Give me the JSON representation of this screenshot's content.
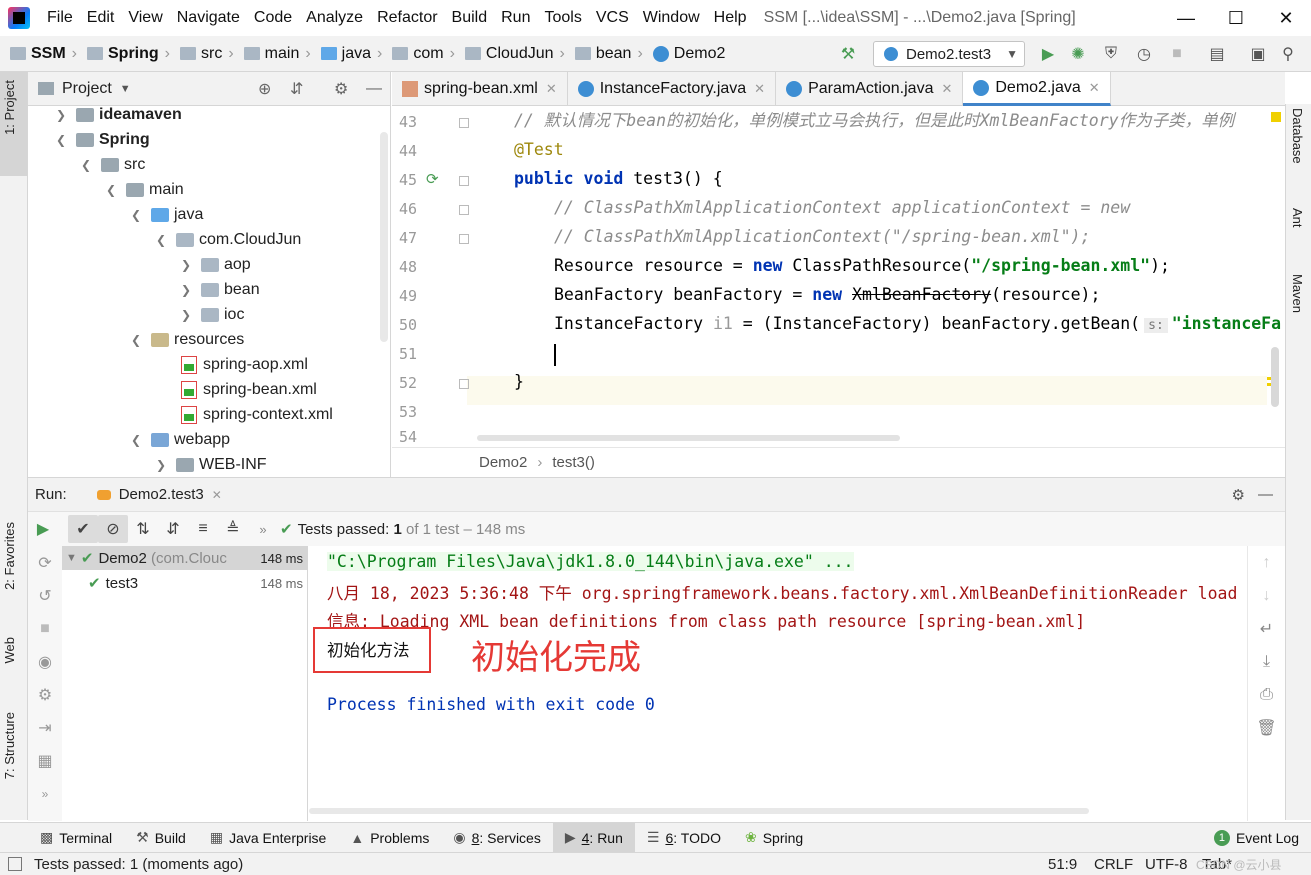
{
  "window": {
    "menu": [
      "File",
      "Edit",
      "View",
      "Navigate",
      "Code",
      "Analyze",
      "Refactor",
      "Build",
      "Run",
      "Tools",
      "VCS",
      "Window",
      "Help"
    ],
    "title": "SSM [...\\idea\\SSM] - ...\\Demo2.java [Spring]"
  },
  "navbar": {
    "breadcrumbs": [
      "SSM",
      "Spring",
      "src",
      "main",
      "java",
      "com",
      "CloudJun",
      "bean",
      "Demo2"
    ],
    "run_config": "Demo2.test3"
  },
  "side_tabs": {
    "left_top": "1: Project",
    "left_favorites": "2: Favorites",
    "left_web": "Web",
    "left_structure": "7: Structure",
    "right": [
      "Database",
      "Ant",
      "Maven"
    ]
  },
  "project": {
    "header": "Project",
    "tree": [
      {
        "label": "ideamaven",
        "bold": true
      },
      {
        "label": "Spring",
        "bold": true
      },
      {
        "label": "src"
      },
      {
        "label": "main"
      },
      {
        "label": "java"
      },
      {
        "label": "com.CloudJun"
      },
      {
        "label": "aop"
      },
      {
        "label": "bean"
      },
      {
        "label": "ioc"
      },
      {
        "label": "resources"
      },
      {
        "label": "spring-aop.xml"
      },
      {
        "label": "spring-bean.xml"
      },
      {
        "label": "spring-context.xml"
      },
      {
        "label": "webapp"
      },
      {
        "label": "WEB-INF"
      }
    ]
  },
  "editor": {
    "tabs": [
      "spring-bean.xml",
      "InstanceFactory.java",
      "ParamAction.java",
      "Demo2.java"
    ],
    "active_tab": "Demo2.java",
    "line_numbers": [
      "43",
      "44",
      "45",
      "46",
      "47",
      "48",
      "49",
      "50",
      "51",
      "52",
      "53",
      "54"
    ],
    "lines": {
      "l43": "// 默认情况下bean的初始化，单例模式立马会执行，但是此时XmlBeanFactory作为子类，单例",
      "l44": "@Test",
      "l45_kw1": "public",
      "l45_kw2": "void",
      "l45_rest": " test3() {",
      "l46": "// ClassPathXmlApplicationContext applicationContext = new",
      "l47": "// ClassPathXmlApplicationContext(\"/spring-bean.xml\");",
      "l48_a": "Resource resource = ",
      "l48_kw": "new",
      "l48_b": " ClassPathResource(",
      "l48_str": "\"/spring-bean.xml\"",
      "l48_c": ");",
      "l49_a": "BeanFactory beanFactory = ",
      "l49_kw": "new",
      "l49_strike": "XmlBeanFactory",
      "l49_c": "(resource);",
      "l50_a": "InstanceFactory ",
      "l50_var": "i1",
      "l50_b": " = (InstanceFactory) beanFactory.getBean(",
      "l50_hint": "s:",
      "l50_str": "\"instanceFa",
      "l52": "}"
    },
    "breadcrumb": [
      "Demo2",
      "test3()"
    ]
  },
  "run": {
    "label": "Run:",
    "tab": "Demo2.test3",
    "status_prefix": "Tests passed:",
    "status_count": "1",
    "status_suffix": "of 1 test – 148 ms",
    "tree": [
      {
        "name": "Demo2",
        "detail": "(com.Clouc",
        "time": "148 ms"
      },
      {
        "name": "test3",
        "time": "148 ms"
      }
    ],
    "console": [
      "\"C:\\Program Files\\Java\\jdk1.8.0_144\\bin\\java.exe\" ...",
      "八月 18, 2023 5:36:48 下午 org.springframework.beans.factory.xml.XmlBeanDefinitionReader load",
      "信息: Loading XML bean definitions from class path resource [spring-bean.xml]",
      "初始化方法",
      "Process finished with exit code 0"
    ],
    "annotation": "初始化完成"
  },
  "bottom_tools": [
    {
      "key": "",
      "label": "Terminal"
    },
    {
      "key": "",
      "label": "Build"
    },
    {
      "key": "",
      "label": "Java Enterprise"
    },
    {
      "key": "",
      "label": "Problems"
    },
    {
      "key": "8",
      "label": ": Services"
    },
    {
      "key": "4",
      "label": ": Run"
    },
    {
      "key": "6",
      "label": ": TODO"
    },
    {
      "key": "",
      "label": "Spring"
    }
  ],
  "event_log": {
    "count": "1",
    "label": "Event Log"
  },
  "status": {
    "message": "Tests passed: 1 (moments ago)",
    "position": "51:9",
    "line_sep": "CRLF",
    "encoding": "UTF-8",
    "indent": "Tab*",
    "watermark": "CSDN @云小县"
  },
  "colors": {
    "accent": "#4083c9",
    "success": "#499c54",
    "error_text": "#a31515",
    "highlight_box": "#e53935"
  }
}
